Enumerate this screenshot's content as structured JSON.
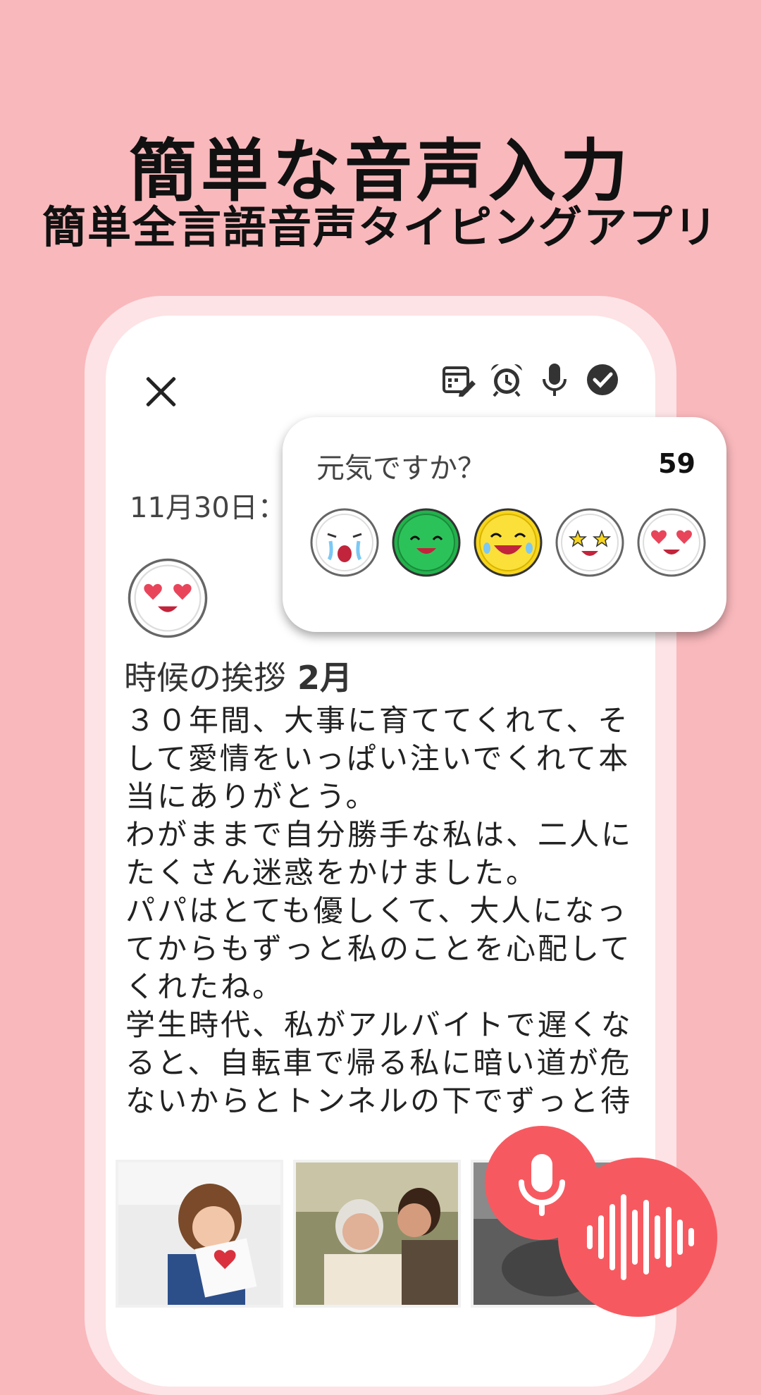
{
  "headline": "簡単な音声入力",
  "subline": "簡単全言語音声タイピングアプリ",
  "toolbar": {
    "icons": [
      "calendar-edit-icon",
      "alarm-clock-icon",
      "microphone-icon",
      "check-circle-icon"
    ]
  },
  "entry": {
    "date": "11月30日：",
    "title": "時候の挨拶",
    "title_month": "2月",
    "body": "３０年間、大事に育ててくれて、そして愛情をいっぱい注いでくれて本当にありがとう。\nわがままで自分勝手な私は、二人にたくさん迷惑をかけました。\nパパはとても優しくて、大人になってからもずっと私のことを心配してくれたね。\n学生時代、私がアルバイトで遅くなると、自転車で帰る私に暗い道が危ないからとトンネルの下でずっと待"
  },
  "mood_popup": {
    "question": "元気ですか？",
    "count": "59",
    "moods": [
      "crying-face-icon",
      "happy-green-face-icon",
      "laughing-yellow-face-icon",
      "star-eyes-face-icon",
      "heart-eyes-face-icon"
    ]
  },
  "colors": {
    "background": "#f9b8bc",
    "accent": "#f65a60",
    "green": "#22b24c",
    "yellow": "#f7d51b"
  }
}
